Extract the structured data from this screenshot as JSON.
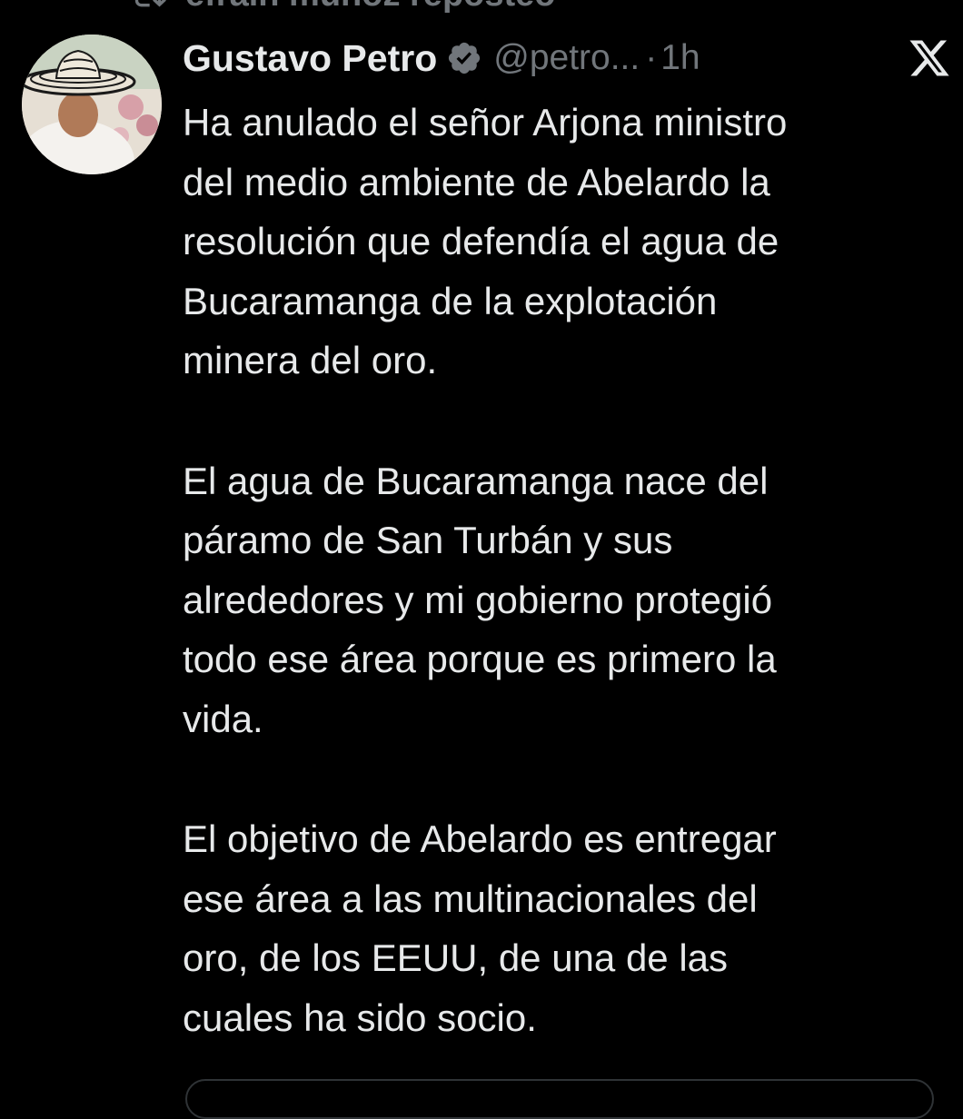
{
  "repost": {
    "text": "efrain muñoz reposteó"
  },
  "tweet": {
    "author": {
      "display_name": "Gustavo Petro",
      "verified": true,
      "handle": "@petro...",
      "separator": "·",
      "timestamp": "1h"
    },
    "paragraphs": [
      {
        "lines": [
          "Ha anulado el señor Arjona ministro",
          "del medio ambiente de Abelardo la",
          "resolución que defendía el agua de",
          "Bucaramanga de la explotación",
          "minera del oro."
        ]
      },
      {
        "lines": [
          "El agua de Bucaramanga nace del",
          "páramo de San Turbán y sus",
          "alrededores y mi gobierno protegió",
          "todo ese área porque es primero la",
          "vida."
        ]
      },
      {
        "lines": [
          "El objetivo de Abelardo es entregar",
          "ese área a las multinacionales del",
          "oro, de los EEUU, de una de las",
          "cuales ha sido socio."
        ]
      }
    ]
  },
  "icons": {
    "repost": "repost-icon",
    "verified": "verified-badge-icon",
    "platform": "x-logo-icon"
  },
  "colors": {
    "background": "#000000",
    "text_primary": "#e7e9ea",
    "text_secondary": "#71767b",
    "divider": "#2f3336"
  }
}
